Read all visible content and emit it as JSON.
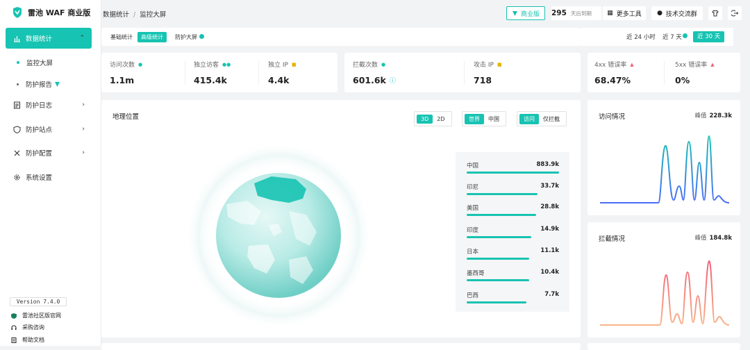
{
  "brand": {
    "name": "雷池 WAF 商业版"
  },
  "sidebar": {
    "items": [
      {
        "label": "数据统计",
        "icon": "bar-chart-icon"
      },
      {
        "label": "防护日志",
        "icon": "log-icon"
      },
      {
        "label": "防护站点",
        "icon": "shield-icon"
      },
      {
        "label": "防护配置",
        "icon": "tools-icon"
      },
      {
        "label": "系统设置",
        "icon": "gear-icon"
      }
    ],
    "sub_items": [
      {
        "label": "监控大屏"
      },
      {
        "label": "防护报告"
      }
    ],
    "version": "Version 7.4.0",
    "footer": [
      {
        "label": "雷池社区版官网",
        "icon": "shield-small-icon"
      },
      {
        "label": "采购咨询",
        "icon": "headset-icon"
      },
      {
        "label": "帮助文档",
        "icon": "doc-icon"
      }
    ]
  },
  "header": {
    "breadcrumb": [
      "数据统计",
      "监控大屏"
    ],
    "edition": "商业版",
    "days_num": "295",
    "days_text": "天后到期",
    "more_tools": "更多工具",
    "tech_group": "技术交流群"
  },
  "tabs": [
    "基础统计",
    "高级统计",
    "防护大屏"
  ],
  "ranges": [
    "近 24 小时",
    "近 7 天",
    "近 30 天"
  ],
  "stats": [
    {
      "label": "访问次数",
      "value": "1.1m"
    },
    {
      "label": "独立访客",
      "value": "415.4k"
    },
    {
      "label": "独立 IP",
      "value": "4.4k"
    },
    {
      "label": "拦截次数",
      "value": "601.6k"
    },
    {
      "label": "攻击 IP",
      "value": "718"
    },
    {
      "label": "4xx 错误率",
      "value": "68.47%"
    },
    {
      "label": "5xx 错误率",
      "value": "0%"
    }
  ],
  "geo": {
    "title": "地理位置",
    "view_modes": [
      "3D",
      "2D"
    ],
    "scopes": [
      "世界",
      "中国"
    ],
    "filters": [
      "访问",
      "仅拦截"
    ],
    "ranking": [
      {
        "country": "中国",
        "value": "883.9k",
        "ratio": 1.0
      },
      {
        "country": "印尼",
        "value": "33.7k",
        "ratio": 0.77
      },
      {
        "country": "美国",
        "value": "28.8k",
        "ratio": 0.75
      },
      {
        "country": "印度",
        "value": "14.9k",
        "ratio": 0.7
      },
      {
        "country": "日本",
        "value": "11.1k",
        "ratio": 0.68
      },
      {
        "country": "墨西哥",
        "value": "10.4k",
        "ratio": 0.68
      },
      {
        "country": "巴西",
        "value": "7.7k",
        "ratio": 0.65
      }
    ]
  },
  "visits": {
    "title": "访问情况",
    "peak_label": "峰值",
    "peak_value": "228.3k",
    "color_from": "#4a6cf7",
    "color_to": "#17c3b2"
  },
  "blocks": {
    "title": "拦截情况",
    "peak_label": "峰值",
    "peak_value": "184.8k",
    "color_from": "#f7b48a",
    "color_to": "#f2607a"
  },
  "colors": {
    "accent": "#17c3b2"
  }
}
